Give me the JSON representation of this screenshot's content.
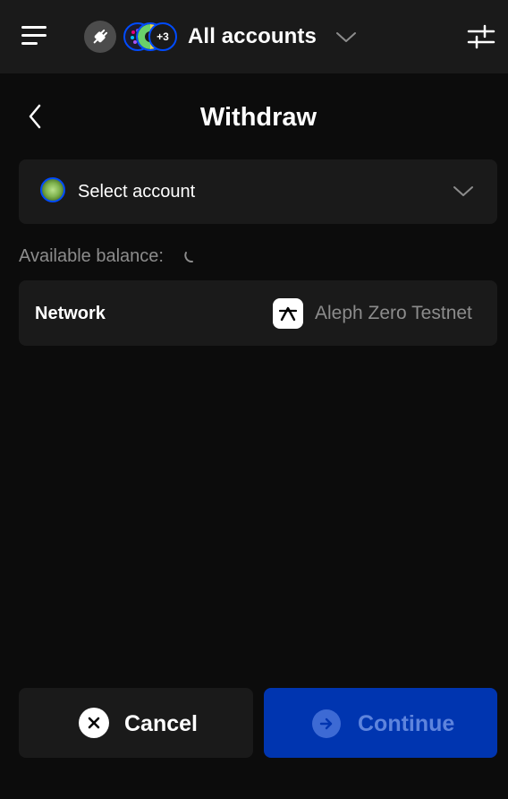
{
  "header": {
    "account_title": "All accounts",
    "account_overflow_count": "+3"
  },
  "page": {
    "title": "Withdraw"
  },
  "account_selector": {
    "label": "Select account"
  },
  "balance": {
    "label": "Available balance:"
  },
  "network": {
    "label": "Network",
    "value": "Aleph Zero Testnet"
  },
  "footer": {
    "cancel_label": "Cancel",
    "continue_label": "Continue"
  },
  "icons": {
    "menu": "hamburger-menu-icon",
    "connect": "plug-icon",
    "dropdown": "chevron-down-icon",
    "settings": "sliders-icon",
    "back": "chevron-left-icon",
    "loading": "spinner-icon",
    "cancel": "x-circle-icon",
    "continue": "arrow-right-circle-icon"
  },
  "colors": {
    "background": "#0c0c0c",
    "surface": "#1a1a1a",
    "primary": "#004bff",
    "primary_disabled": "#0035b0",
    "muted_text": "#8c8c8c"
  }
}
